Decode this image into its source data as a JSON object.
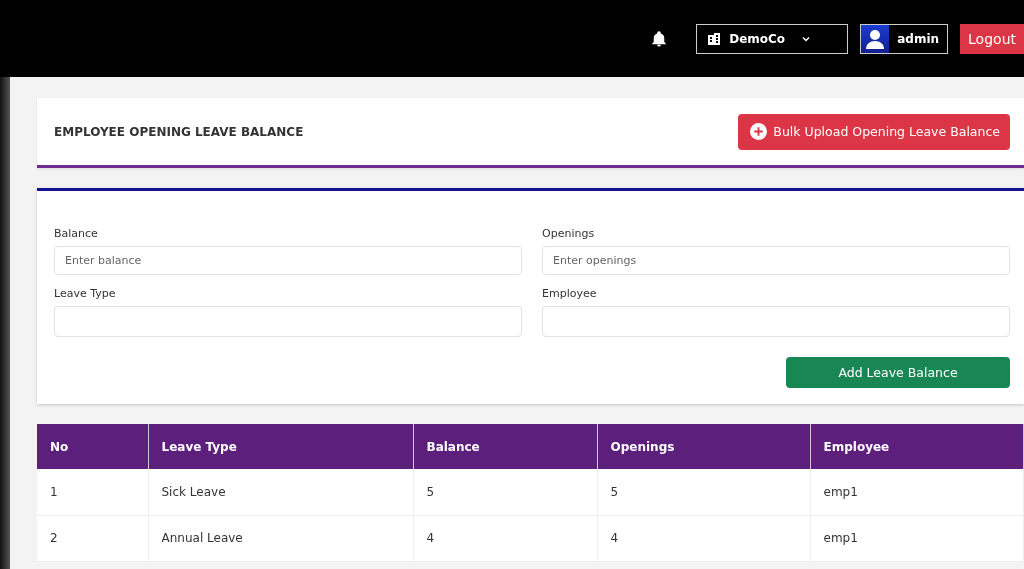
{
  "topbar": {
    "company": "DemoCo",
    "user": "admin",
    "logout": "Logout"
  },
  "header": {
    "title": "EMPLOYEE OPENING LEAVE BALANCE",
    "bulk_button": "Bulk Upload Opening Leave Balance"
  },
  "form": {
    "fields": [
      {
        "label": "Balance",
        "placeholder": "Enter balance"
      },
      {
        "label": "Openings",
        "placeholder": "Enter openings"
      },
      {
        "label": "Leave Type"
      },
      {
        "label": "Employee"
      }
    ],
    "submit": "Add Leave Balance"
  },
  "table": {
    "columns": [
      "No",
      "Leave Type",
      "Balance",
      "Openings",
      "Employee"
    ],
    "rows": [
      [
        "1",
        "Sick Leave",
        "5",
        "5",
        "emp1"
      ],
      [
        "2",
        "Annual Leave",
        "4",
        "4",
        "emp1"
      ]
    ]
  }
}
